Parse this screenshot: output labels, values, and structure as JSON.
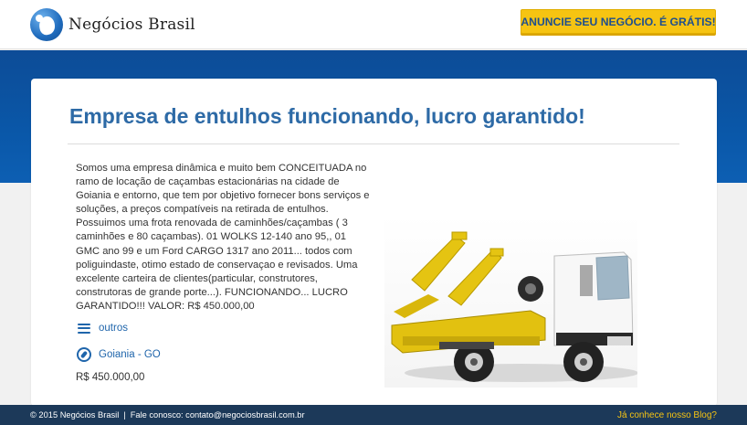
{
  "header": {
    "logo_text": "Negócios Brasil",
    "cta_label": "ANUNCIE SEU NEGÓCIO. É GRÁTIS!"
  },
  "listing": {
    "title": "Empresa de entulhos funcionando, lucro garantido!",
    "description": "Somos uma empresa dinâmica e muito bem CONCEITUADA no ramo de locação de caçambas estacionárias na cidade de Goiania e entorno, que tem por objetivo fornecer bons serviços e soluções, a preços compatíveis na retirada de entulhos. Possuimos uma frota renovada de caminhões/caçambas ( 3 caminhões e 80 caçambas). 01 WOLKS 12-140 ano 95,, 01 GMC ano 99 e um Ford CARGO 1317 ano 2011... todos com poliguindaste, otimo estado de conservaçao e revisados. Uma excelente carteira de clientes(particular, construtores, construtoras de grande porte...). FUNCIONANDO... LUCRO GARANTIDO!!! VALOR: R$ 450.000,00",
    "category": "outros",
    "location": "Goiania - GO",
    "price": "R$ 450.000,00",
    "category_icon": "menu-icon",
    "location_icon": "compass-icon"
  },
  "footer": {
    "copyright": "© 2015 Negócios Brasil",
    "separator": "|",
    "contact": "Fale conosco: contato@negociosbrasil.com.br",
    "blog_link": "Já conhece nosso Blog?"
  },
  "colors": {
    "brand_blue": "#2d6aa6",
    "band_blue": "#0a57a8",
    "cta_yellow": "#f6c412",
    "footer_navy": "#1c3959"
  }
}
